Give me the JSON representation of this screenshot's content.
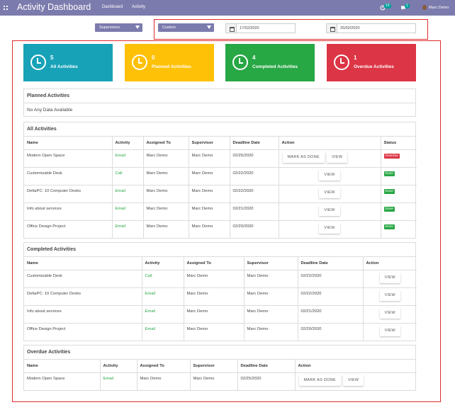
{
  "header": {
    "title": "Activity Dashboard",
    "menu": [
      "Dashboard",
      "Activity"
    ],
    "activity_badge": "14",
    "message_badge": "1",
    "user": "Marc Demo"
  },
  "filters": {
    "group_by": "Supervisors",
    "period": "Custom",
    "date_from": "17/02/2020",
    "date_to": "25/02/2020"
  },
  "cards": [
    {
      "count": "5",
      "label": "All Activities",
      "color": "#17a2b8"
    },
    {
      "count": "0",
      "label": "Planned Activities",
      "color": "#ffc107"
    },
    {
      "count": "4",
      "label": "Completed Activities",
      "color": "#28a745"
    },
    {
      "count": "1",
      "label": "Overdue Activities",
      "color": "#dc3545"
    }
  ],
  "planned": {
    "title": "Planned Activities",
    "empty": "No Any Data Available"
  },
  "all": {
    "title": "All Activities",
    "columns": [
      "Name",
      "Activity",
      "Assigned To",
      "Supervisor",
      "Deadline Date",
      "Action",
      "Status"
    ],
    "rows": [
      {
        "name": "Modern Open Space",
        "activity": "Email",
        "assigned": "Marc Demo",
        "supervisor": "Marc Demo",
        "deadline": "02/25/2020",
        "status": "Overdue"
      },
      {
        "name": "Customizable Desk",
        "activity": "Call",
        "assigned": "Marc Demo",
        "supervisor": "Marc Demo",
        "deadline": "02/22/2020",
        "status": "Done"
      },
      {
        "name": "DeltaPC: 10 Computer Desks",
        "activity": "Email",
        "assigned": "Marc Demo",
        "supervisor": "Marc Demo",
        "deadline": "02/22/2020",
        "status": "Done"
      },
      {
        "name": "Info about services",
        "activity": "Email",
        "assigned": "Marc Demo",
        "supervisor": "Marc Demo",
        "deadline": "02/21/2020",
        "status": "Done"
      },
      {
        "name": "Office Design Project",
        "activity": "Email",
        "assigned": "Marc Demo",
        "supervisor": "Marc Demo",
        "deadline": "02/20/2020",
        "status": "Done"
      }
    ]
  },
  "completed": {
    "title": "Completed Activities",
    "columns": [
      "Name",
      "Activity",
      "Assigned To",
      "Supervisor",
      "Deadline Date",
      "Action"
    ],
    "rows": [
      {
        "name": "Customizable Desk",
        "activity": "Call",
        "assigned": "Marc Demo",
        "supervisor": "Marc Demo",
        "deadline": "02/22/2020"
      },
      {
        "name": "DeltaPC: 10 Computer Desks",
        "activity": "Email",
        "assigned": "Marc Demo",
        "supervisor": "Marc Demo",
        "deadline": "02/22/2020"
      },
      {
        "name": "Info about services",
        "activity": "Email",
        "assigned": "Marc Demo",
        "supervisor": "Marc Demo",
        "deadline": "02/21/2020"
      },
      {
        "name": "Office Design Project",
        "activity": "Email",
        "assigned": "Marc Demo",
        "supervisor": "Marc Demo",
        "deadline": "02/20/2020"
      }
    ]
  },
  "overdue": {
    "title": "Overdue Activities",
    "columns": [
      "Name",
      "Activity",
      "Assigned To",
      "Supervisor",
      "Deadline Date",
      "Action"
    ],
    "rows": [
      {
        "name": "Modern Open Space",
        "activity": "Email",
        "assigned": "Marc Demo",
        "supervisor": "Marc Demo",
        "deadline": "02/25/2020"
      }
    ]
  },
  "buttons": {
    "mark_done": "MARK AS DONE",
    "view": "VIEW"
  },
  "status_colors": {
    "Overdue": "#dc3545",
    "Done": "#28a745"
  }
}
